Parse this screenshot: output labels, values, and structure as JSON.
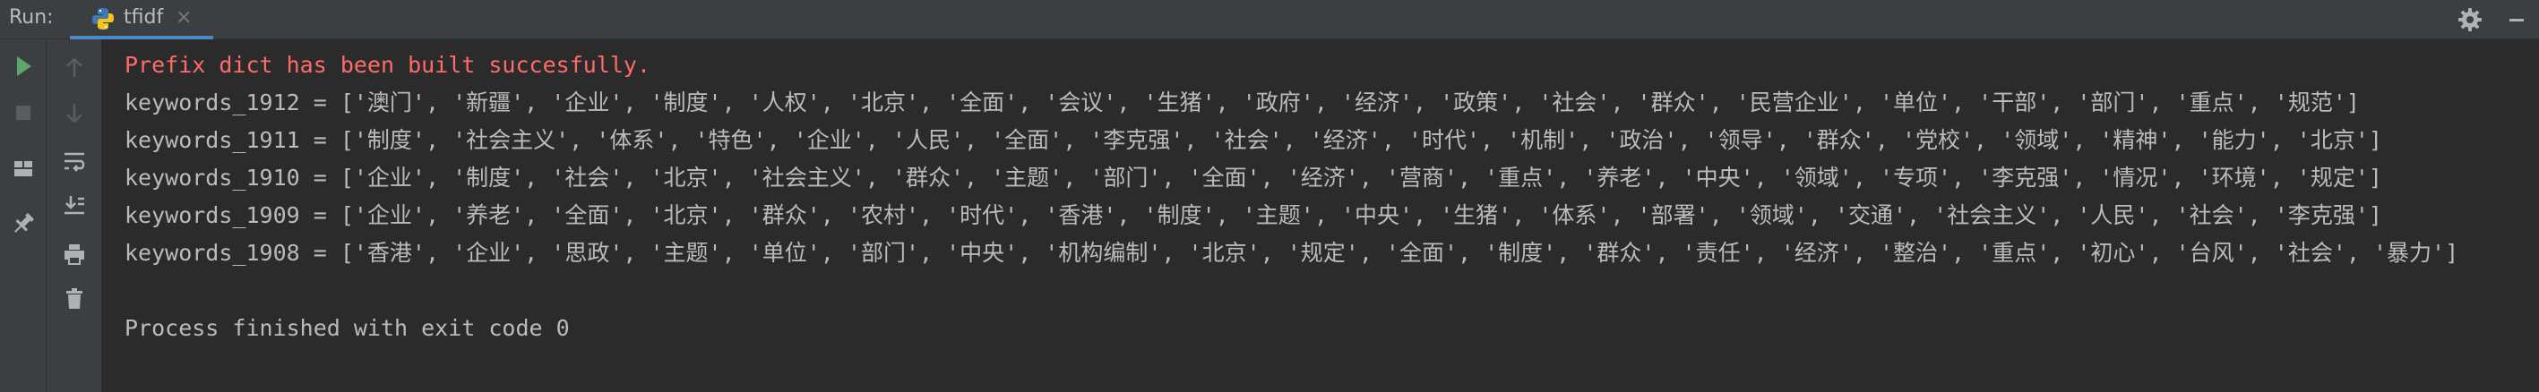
{
  "header": {
    "run_label": "Run:",
    "tab": {
      "label": "tfidf",
      "close": "×",
      "icon": "python-icon"
    },
    "right_icons": [
      "gear-icon",
      "minimize-icon"
    ]
  },
  "toolbar_left": {
    "items": [
      "rerun-icon",
      "stop-icon",
      "layout-icon",
      "pin-icon"
    ]
  },
  "toolbar_right": {
    "items": [
      "up-arrow-icon",
      "down-arrow-icon",
      "soft-wrap-icon",
      "scroll-to-end-icon",
      "print-icon",
      "trash-icon"
    ]
  },
  "console": {
    "lines": [
      "Prefix dict has been built succesfully.",
      "keywords_1912 = ['澳门', '新疆', '企业', '制度', '人权', '北京', '全面', '会议', '生猪', '政府', '经济', '政策', '社会', '群众', '民营企业', '单位', '干部', '部门', '重点', '规范']",
      "keywords_1911 = ['制度', '社会主义', '体系', '特色', '企业', '人民', '全面', '李克强', '社会', '经济', '时代', '机制', '政治', '领导', '群众', '党校', '领域', '精神', '能力', '北京']",
      "keywords_1910 = ['企业', '制度', '社会', '北京', '社会主义', '群众', '主题', '部门', '全面', '经济', '营商', '重点', '养老', '中央', '领域', '专项', '李克强', '情况', '环境', '规定']",
      "keywords_1909 = ['企业', '养老', '全面', '北京', '群众', '农村', '时代', '香港', '制度', '主题', '中央', '生猪', '体系', '部署', '领域', '交通', '社会主义', '人民', '社会', '李克强']",
      "keywords_1908 = ['香港', '企业', '思政', '主题', '单位', '部门', '中央', '机构编制', '北京', '规定', '全面', '制度', '群众', '责任', '经济', '整治', '重点', '初心', '台风', '社会', '暴力']",
      "",
      "Process finished with exit code 0"
    ]
  },
  "colors": {
    "background": "#2b2b2b",
    "panel": "#3c3f41",
    "text": "#bbbbbb",
    "error_text": "#ff6b68",
    "run_green": "#59a869",
    "tab_underline": "#4a88c7"
  }
}
